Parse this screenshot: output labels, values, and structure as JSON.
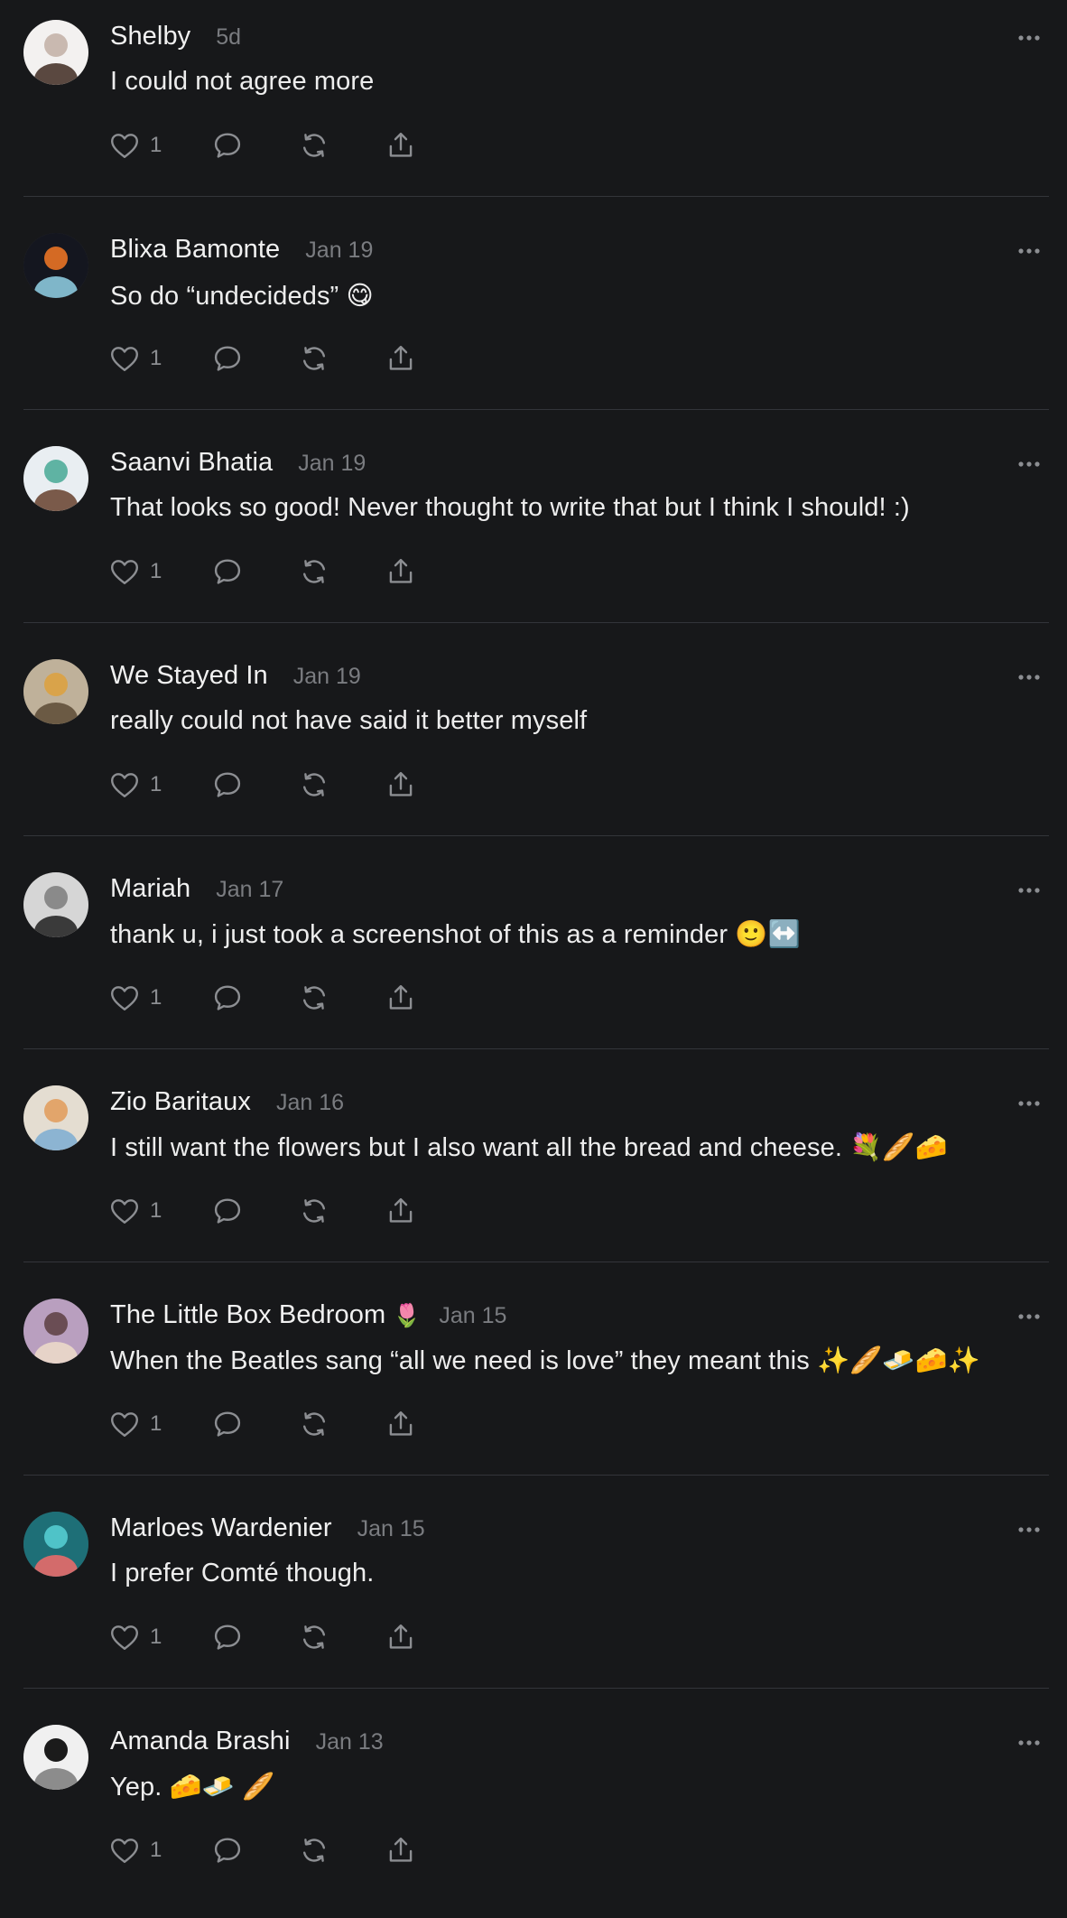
{
  "posts": [
    {
      "author": "Shelby",
      "badge": "",
      "time": "5d",
      "text": "I could not agree more",
      "likes": "1",
      "avatar_colors": [
        "#f3f1f0",
        "#c9b9b0",
        "#5a4840"
      ]
    },
    {
      "author": "Blixa Bamonte",
      "badge": "",
      "time": "Jan 19",
      "text": "So do “undecideds” 😋",
      "likes": "1",
      "avatar_colors": [
        "#14161f",
        "#d46a24",
        "#7fb6c9"
      ]
    },
    {
      "author": "Saanvi Bhatia",
      "badge": "",
      "time": "Jan 19",
      "text": "That looks so good! Never thought to write that but I think I should! :)",
      "likes": "1",
      "avatar_colors": [
        "#e9eef2",
        "#5fb3a3",
        "#7a5a4a"
      ]
    },
    {
      "author": "We Stayed In",
      "badge": "",
      "time": "Jan 19",
      "text": "really could not have said it better myself",
      "likes": "1",
      "avatar_colors": [
        "#bfb19a",
        "#d9a34a",
        "#6b5a44"
      ]
    },
    {
      "author": "Mariah",
      "badge": "",
      "time": "Jan 17",
      "text": "thank u, i just took a screenshot of this as a reminder 🙂↔️",
      "likes": "1",
      "avatar_colors": [
        "#d6d6d6",
        "#8a8a8a",
        "#3a3a3a"
      ]
    },
    {
      "author": "Zio Baritaux",
      "badge": "",
      "time": "Jan 16",
      "text": "I still want the flowers but I also want all the bread and cheese. 💐🥖🧀",
      "likes": "1",
      "avatar_colors": [
        "#e4ddd1",
        "#e2a56b",
        "#8cb4d2"
      ]
    },
    {
      "author": "The Little Box Bedroom",
      "badge": "🌷",
      "time": "Jan 15",
      "text": "When the Beatles sang “all we need is love” they meant this ✨🥖🧈🧀✨",
      "likes": "1",
      "avatar_colors": [
        "#b99fbf",
        "#6a4d54",
        "#e6d3c8"
      ]
    },
    {
      "author": "Marloes Wardenier",
      "badge": "",
      "time": "Jan 15",
      "text": "I prefer Comté though.",
      "likes": "1",
      "avatar_colors": [
        "#1e6f77",
        "#4fc3c8",
        "#d36b6b"
      ]
    },
    {
      "author": "Amanda Brashi",
      "badge": "",
      "time": "Jan 13",
      "text": "Yep. 🧀🧈 🥖",
      "likes": "1",
      "avatar_colors": [
        "#f0f0f0",
        "#1b1b1b",
        "#8c8c8c"
      ]
    }
  ],
  "icons": {
    "more": "more-horizontal-icon",
    "like": "heart-icon",
    "reply": "comment-icon",
    "repost": "repost-icon",
    "share": "share-icon"
  },
  "colors": {
    "background": "#17181a",
    "divider": "#33353a",
    "primary_text": "#ededed",
    "secondary_text": "#7a7c80",
    "icon": "#8c8e92"
  }
}
